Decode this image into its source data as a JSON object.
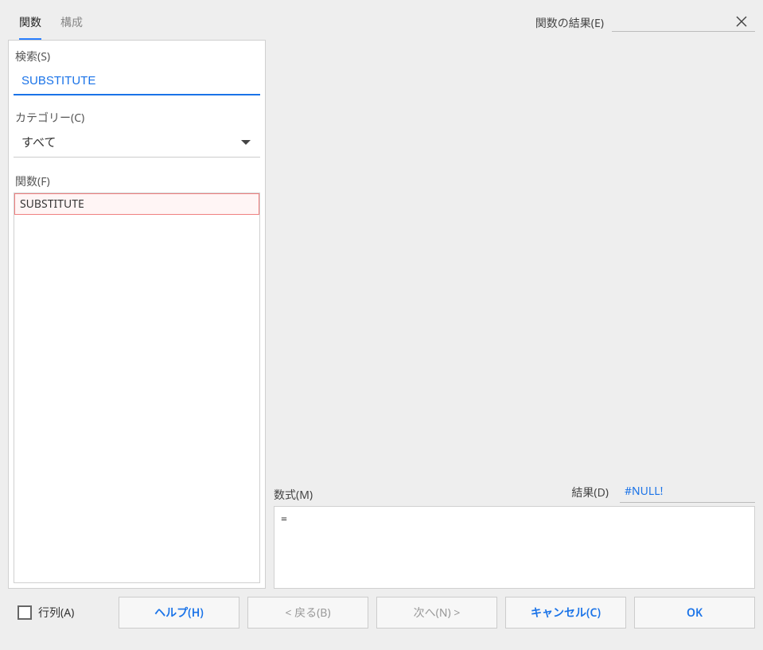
{
  "tabs": {
    "functions": "関数",
    "structure": "構成"
  },
  "left": {
    "search_label": "検索(S)",
    "search_value": "SUBSTITUTE",
    "category_label": "カテゴリー(C)",
    "category_value": "すべて",
    "function_label": "関数(F)",
    "function_items": [
      "SUBSTITUTE"
    ]
  },
  "right": {
    "result_label": "関数の結果(E)",
    "formula_label": "数式(M)",
    "formula_value": "=",
    "rd_label": "結果(D)",
    "rd_value": "#NULL!"
  },
  "footer": {
    "rowcol_label": "行列(A)",
    "help": "ヘルプ(H)",
    "back": "< 戻る(B)",
    "next": "次へ(N) >",
    "cancel": "キャンセル(C)",
    "ok": "OK"
  }
}
